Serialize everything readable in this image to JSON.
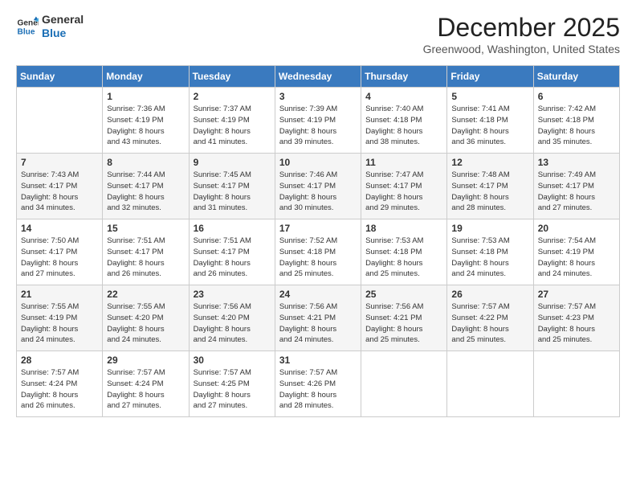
{
  "header": {
    "logo_line1": "General",
    "logo_line2": "Blue",
    "month": "December 2025",
    "location": "Greenwood, Washington, United States"
  },
  "days_header": [
    "Sunday",
    "Monday",
    "Tuesday",
    "Wednesday",
    "Thursday",
    "Friday",
    "Saturday"
  ],
  "weeks": [
    [
      {
        "day": "",
        "info": ""
      },
      {
        "day": "1",
        "info": "Sunrise: 7:36 AM\nSunset: 4:19 PM\nDaylight: 8 hours\nand 43 minutes."
      },
      {
        "day": "2",
        "info": "Sunrise: 7:37 AM\nSunset: 4:19 PM\nDaylight: 8 hours\nand 41 minutes."
      },
      {
        "day": "3",
        "info": "Sunrise: 7:39 AM\nSunset: 4:19 PM\nDaylight: 8 hours\nand 39 minutes."
      },
      {
        "day": "4",
        "info": "Sunrise: 7:40 AM\nSunset: 4:18 PM\nDaylight: 8 hours\nand 38 minutes."
      },
      {
        "day": "5",
        "info": "Sunrise: 7:41 AM\nSunset: 4:18 PM\nDaylight: 8 hours\nand 36 minutes."
      },
      {
        "day": "6",
        "info": "Sunrise: 7:42 AM\nSunset: 4:18 PM\nDaylight: 8 hours\nand 35 minutes."
      }
    ],
    [
      {
        "day": "7",
        "info": "Sunrise: 7:43 AM\nSunset: 4:17 PM\nDaylight: 8 hours\nand 34 minutes."
      },
      {
        "day": "8",
        "info": "Sunrise: 7:44 AM\nSunset: 4:17 PM\nDaylight: 8 hours\nand 32 minutes."
      },
      {
        "day": "9",
        "info": "Sunrise: 7:45 AM\nSunset: 4:17 PM\nDaylight: 8 hours\nand 31 minutes."
      },
      {
        "day": "10",
        "info": "Sunrise: 7:46 AM\nSunset: 4:17 PM\nDaylight: 8 hours\nand 30 minutes."
      },
      {
        "day": "11",
        "info": "Sunrise: 7:47 AM\nSunset: 4:17 PM\nDaylight: 8 hours\nand 29 minutes."
      },
      {
        "day": "12",
        "info": "Sunrise: 7:48 AM\nSunset: 4:17 PM\nDaylight: 8 hours\nand 28 minutes."
      },
      {
        "day": "13",
        "info": "Sunrise: 7:49 AM\nSunset: 4:17 PM\nDaylight: 8 hours\nand 27 minutes."
      }
    ],
    [
      {
        "day": "14",
        "info": "Sunrise: 7:50 AM\nSunset: 4:17 PM\nDaylight: 8 hours\nand 27 minutes."
      },
      {
        "day": "15",
        "info": "Sunrise: 7:51 AM\nSunset: 4:17 PM\nDaylight: 8 hours\nand 26 minutes."
      },
      {
        "day": "16",
        "info": "Sunrise: 7:51 AM\nSunset: 4:17 PM\nDaylight: 8 hours\nand 26 minutes."
      },
      {
        "day": "17",
        "info": "Sunrise: 7:52 AM\nSunset: 4:18 PM\nDaylight: 8 hours\nand 25 minutes."
      },
      {
        "day": "18",
        "info": "Sunrise: 7:53 AM\nSunset: 4:18 PM\nDaylight: 8 hours\nand 25 minutes."
      },
      {
        "day": "19",
        "info": "Sunrise: 7:53 AM\nSunset: 4:18 PM\nDaylight: 8 hours\nand 24 minutes."
      },
      {
        "day": "20",
        "info": "Sunrise: 7:54 AM\nSunset: 4:19 PM\nDaylight: 8 hours\nand 24 minutes."
      }
    ],
    [
      {
        "day": "21",
        "info": "Sunrise: 7:55 AM\nSunset: 4:19 PM\nDaylight: 8 hours\nand 24 minutes."
      },
      {
        "day": "22",
        "info": "Sunrise: 7:55 AM\nSunset: 4:20 PM\nDaylight: 8 hours\nand 24 minutes."
      },
      {
        "day": "23",
        "info": "Sunrise: 7:56 AM\nSunset: 4:20 PM\nDaylight: 8 hours\nand 24 minutes."
      },
      {
        "day": "24",
        "info": "Sunrise: 7:56 AM\nSunset: 4:21 PM\nDaylight: 8 hours\nand 24 minutes."
      },
      {
        "day": "25",
        "info": "Sunrise: 7:56 AM\nSunset: 4:21 PM\nDaylight: 8 hours\nand 25 minutes."
      },
      {
        "day": "26",
        "info": "Sunrise: 7:57 AM\nSunset: 4:22 PM\nDaylight: 8 hours\nand 25 minutes."
      },
      {
        "day": "27",
        "info": "Sunrise: 7:57 AM\nSunset: 4:23 PM\nDaylight: 8 hours\nand 25 minutes."
      }
    ],
    [
      {
        "day": "28",
        "info": "Sunrise: 7:57 AM\nSunset: 4:24 PM\nDaylight: 8 hours\nand 26 minutes."
      },
      {
        "day": "29",
        "info": "Sunrise: 7:57 AM\nSunset: 4:24 PM\nDaylight: 8 hours\nand 27 minutes."
      },
      {
        "day": "30",
        "info": "Sunrise: 7:57 AM\nSunset: 4:25 PM\nDaylight: 8 hours\nand 27 minutes."
      },
      {
        "day": "31",
        "info": "Sunrise: 7:57 AM\nSunset: 4:26 PM\nDaylight: 8 hours\nand 28 minutes."
      },
      {
        "day": "",
        "info": ""
      },
      {
        "day": "",
        "info": ""
      },
      {
        "day": "",
        "info": ""
      }
    ]
  ]
}
